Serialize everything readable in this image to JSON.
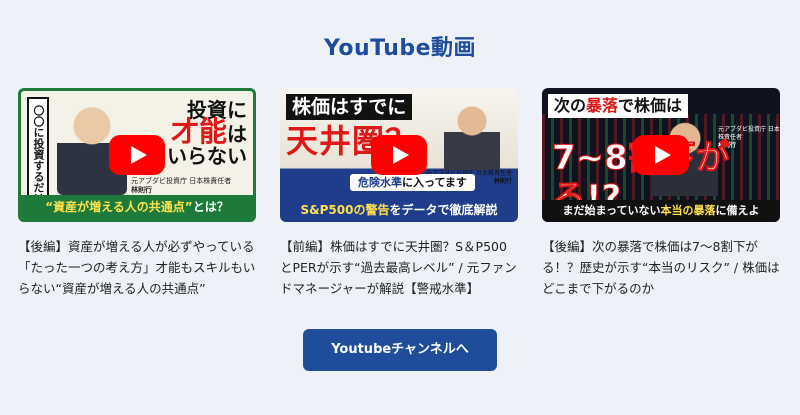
{
  "section": {
    "title": "YouTube動画"
  },
  "videos": [
    {
      "thumb": {
        "vertical": "〇〇に投資するだけ",
        "big_1": "投資に",
        "big_2": "才能",
        "big_3": "は",
        "big_4": "いらない",
        "badge_highlight": "“資産が増える人の共通点”",
        "badge_rest": "とは？",
        "name_role": "元アブダビ投資庁 日本株責任者",
        "name": "林則行"
      },
      "caption": "【後編】資産が増える人が必ずやっている「たった一つの考え方」才能もスキルもいらない“資産が増える人の共通点”"
    },
    {
      "thumb": {
        "top": "株価はすでに",
        "red": "天井圏？",
        "pill_1": "危険水準",
        "pill_2": "に入ってます",
        "bottom_highlight": "S&P500の警告",
        "bottom_rest": "をデータで徹底解説",
        "name_role": "元アブダビ投資庁 日本株責任者",
        "name": "林則行"
      },
      "caption": "【前編】株価はすでに天井圏？S＆P500とPERが示す“過去最高レベル” / 元ファンドマネージャーが解説【警戒水準】"
    },
    {
      "thumb": {
        "top_1": "次の",
        "top_2": "暴落",
        "top_3": "で株価は",
        "big": "7~8割下がる!?",
        "bottom_1": "まだ始まっていない",
        "bottom_2": "本当の暴落",
        "bottom_3": "に備えよ",
        "name_role": "元アブダビ投資庁 日本株責任者",
        "name": "林則行"
      },
      "caption": "【後編】次の暴落で株価は7〜8割下がる！？歴史が示す“本当のリスク” / 株価はどこまで下がるのか"
    }
  ],
  "cta": {
    "label": "Youtubeチャンネルへ"
  },
  "colors": {
    "accent": "#1f4d9b",
    "play": "#ff0000",
    "bg": "#eef2f8"
  }
}
